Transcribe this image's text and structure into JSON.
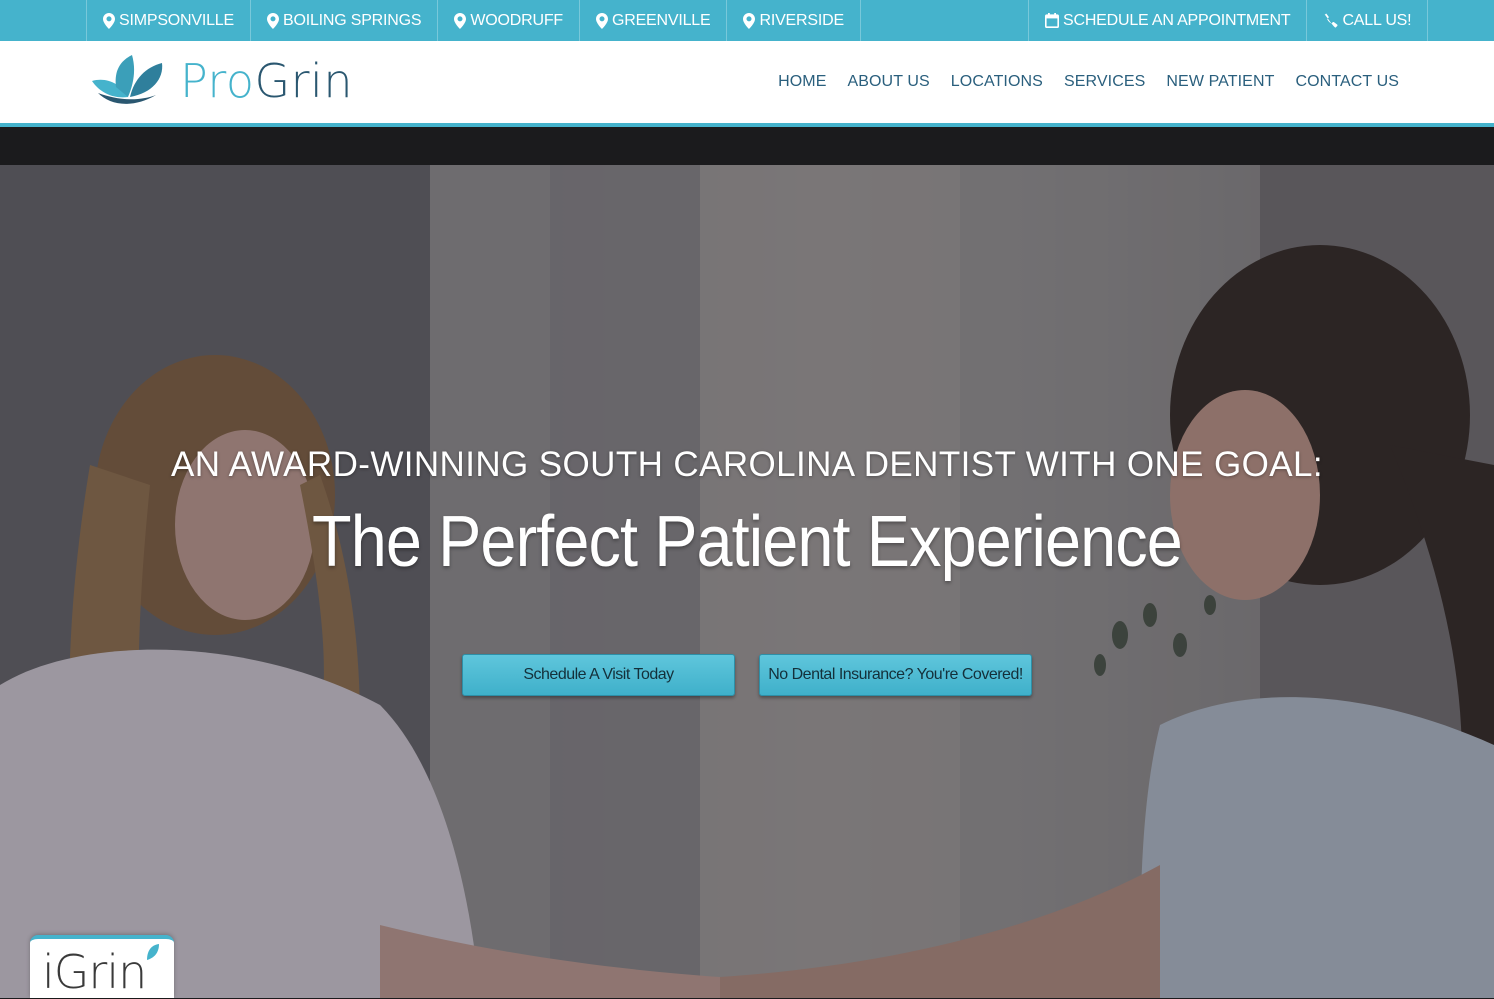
{
  "topbar": {
    "locations": [
      {
        "label": "SIMPSONVILLE",
        "icon": "map-pin-icon"
      },
      {
        "label": "BOILING SPRINGS",
        "icon": "map-pin-icon"
      },
      {
        "label": "WOODRUFF",
        "icon": "map-pin-icon"
      },
      {
        "label": "GREENVILLE",
        "icon": "map-pin-icon"
      },
      {
        "label": "RIVERSIDE",
        "icon": "map-pin-icon"
      }
    ],
    "schedule": {
      "label": "SCHEDULE AN APPOINTMENT",
      "icon": "calendar-icon"
    },
    "call": {
      "label": "CALL US!",
      "icon": "phone-icon"
    }
  },
  "header": {
    "logo": {
      "pro": "Pro",
      "grin": "Grin",
      "icon": "lotus-logo-icon"
    },
    "nav": [
      "HOME",
      "ABOUT US",
      "LOCATIONS",
      "SERVICES",
      "NEW PATIENT",
      "CONTACT US"
    ]
  },
  "hero": {
    "kicker": "AN AWARD-WINNING SOUTH CAROLINA DENTIST WITH ONE GOAL:",
    "title": "The Perfect Patient Experience",
    "buttons": {
      "schedule": "Schedule A Visit Today",
      "insurance": "No Dental Insurance? You're Covered!"
    }
  },
  "badge": {
    "label": "iGrin",
    "icon": "leaf-icon"
  },
  "colors": {
    "accent": "#45b3cc",
    "nav_text": "#2a5f7d",
    "logo_dark": "#2a5770",
    "dark_strip": "#1b1b1d"
  }
}
